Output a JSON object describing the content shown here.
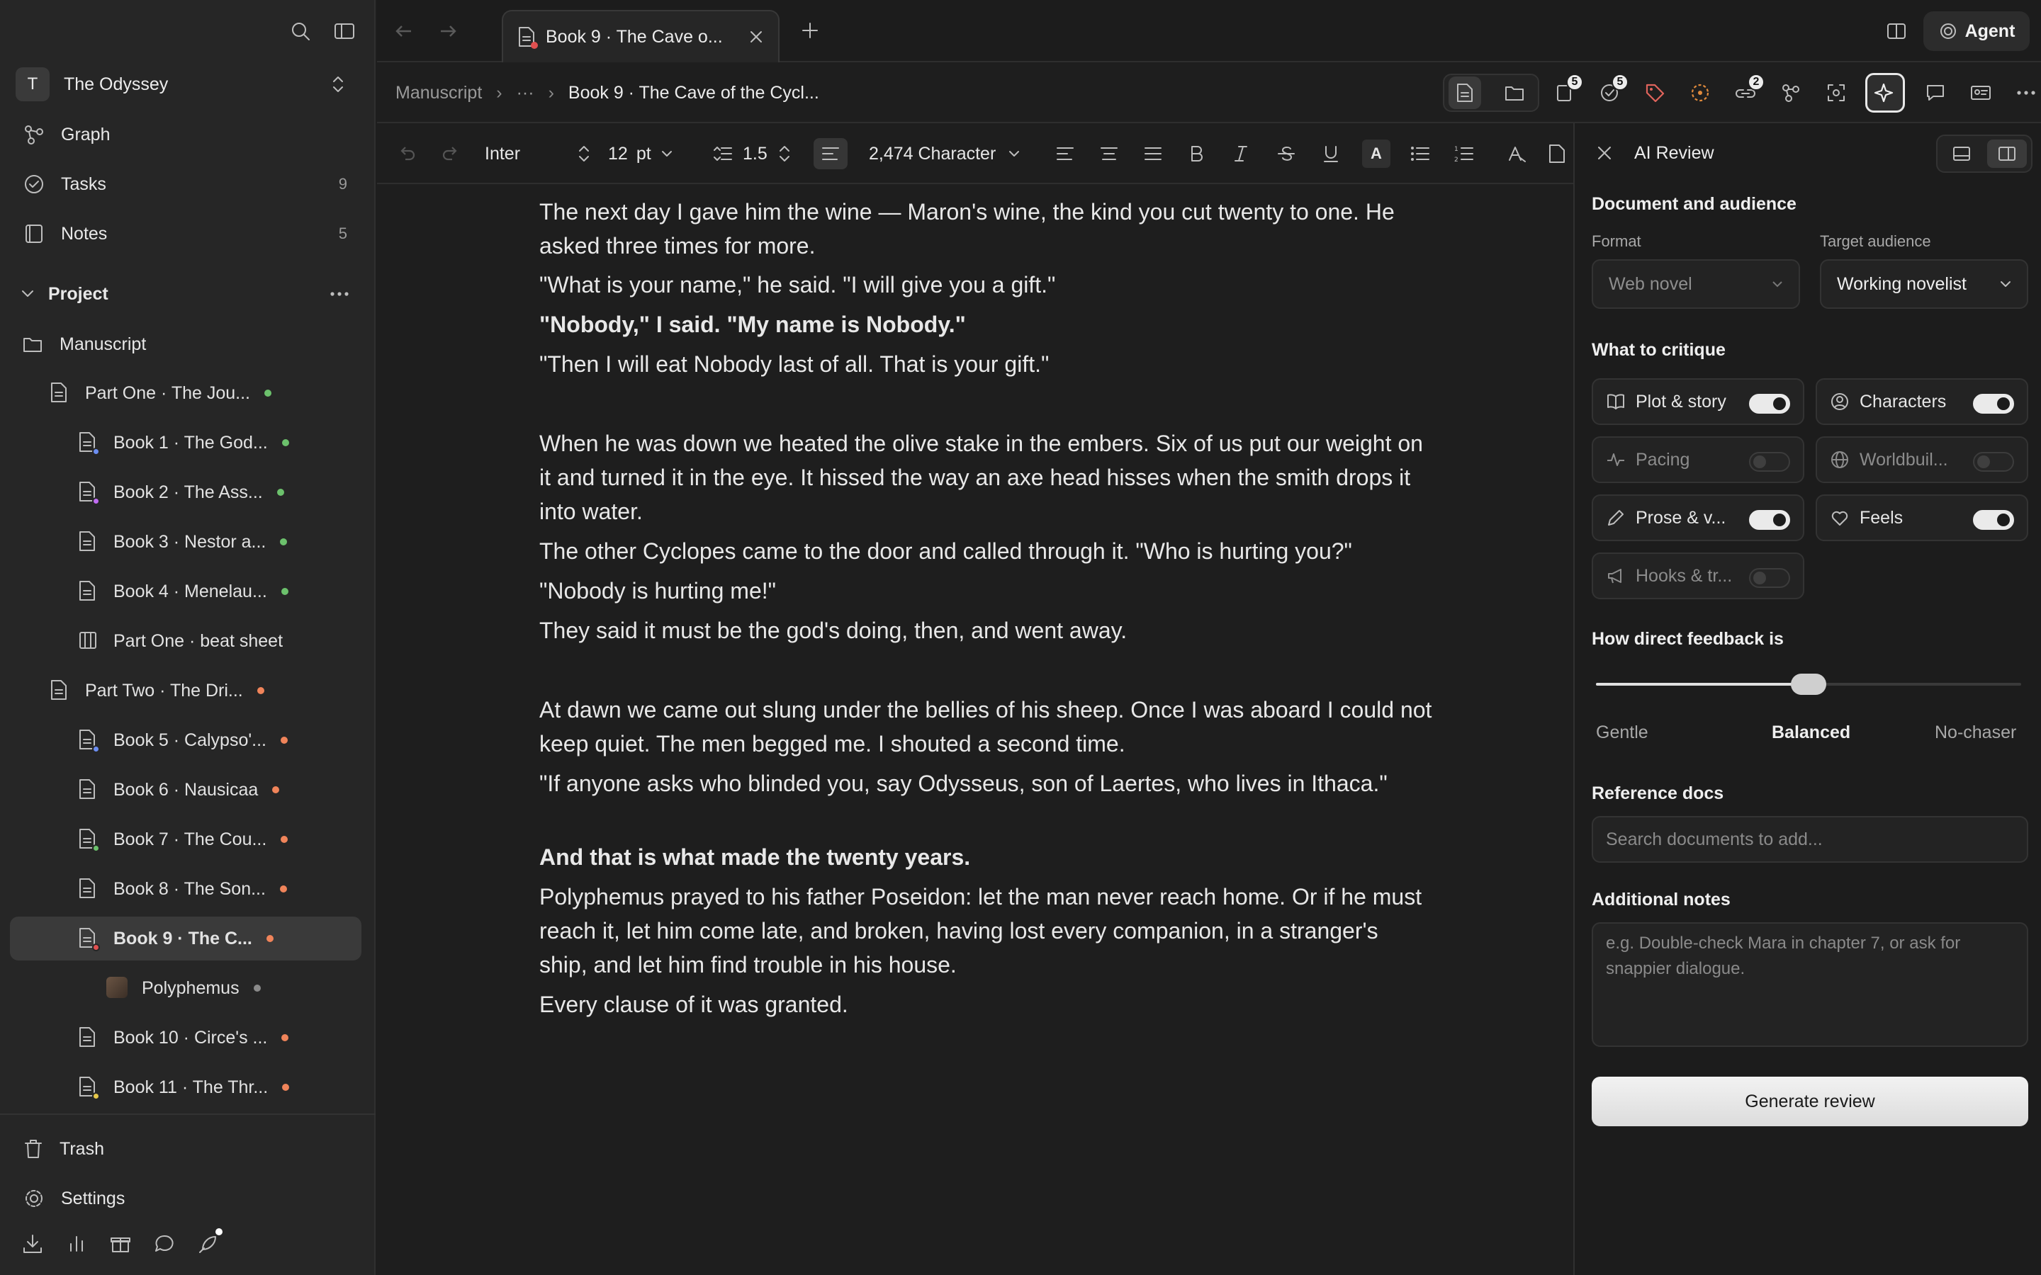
{
  "app": {
    "workspace_initial": "T",
    "workspace_name": "The Odyssey"
  },
  "sidebar": {
    "nav": [
      {
        "label": "Graph"
      },
      {
        "label": "Tasks",
        "count": "9"
      },
      {
        "label": "Notes",
        "count": "5"
      }
    ],
    "project_label": "Project",
    "manuscript_label": "Manuscript",
    "tree": [
      {
        "label": "Part One · The Jou...",
        "dot": "#6cc16c"
      },
      {
        "label": "Book 1 · The God...",
        "dot": "#6cc16c",
        "badge": "#6c8ef2"
      },
      {
        "label": "Book 2 · The Ass...",
        "dot": "#6cc16c",
        "badge": "#c06cf2"
      },
      {
        "label": "Book 3 · Nestor a...",
        "dot": "#6cc16c"
      },
      {
        "label": "Book 4 · Menelau...",
        "dot": "#6cc16c"
      },
      {
        "label": "Part One · beat sheet"
      },
      {
        "label": "Part Two · The Dri...",
        "dot": "#f0845a"
      },
      {
        "label": "Book 5 · Calypso'...",
        "dot": "#f0845a",
        "badge": "#6c8ef2"
      },
      {
        "label": "Book 6 · Nausicaa",
        "dot": "#f0845a"
      },
      {
        "label": "Book 7 · The Cou...",
        "dot": "#f0845a",
        "badge": "#6cc16c"
      },
      {
        "label": "Book 8 · The Son...",
        "dot": "#f0845a"
      },
      {
        "label": "Book 9 · The C...",
        "dot": "#f0845a",
        "badge": "#e05050"
      },
      {
        "label": "Polyphemus",
        "dot": "#8a8a8a"
      },
      {
        "label": "Book 10 · Circe's ...",
        "dot": "#f0845a"
      },
      {
        "label": "Book 11 · The Thr...",
        "dot": "#f0845a",
        "badge": "#e6c84a"
      }
    ],
    "trash_label": "Trash",
    "settings_label": "Settings"
  },
  "tab": {
    "title": "Book 9 · The Cave o..."
  },
  "agent_label": "Agent",
  "breadcrumb": {
    "root": "Manuscript",
    "ellipsis": "···",
    "current": "Book 9 · The Cave of the Cycl..."
  },
  "toolbar_badges": {
    "pages": "5",
    "tasks": "5",
    "links": "2"
  },
  "format": {
    "font": "Inter",
    "size": "12",
    "unit": "pt",
    "line_spacing": "1.5",
    "count": "2,474 Character"
  },
  "editor": {
    "paragraphs": [
      "The next day I gave him the wine — Maron's wine, the kind you cut twenty to one. He asked three times for more.",
      "\"What is your name,\" he said. \"I will give you a gift.\"",
      "\"Nobody,\" I said. \"My name is Nobody.\"",
      "\"Then I will eat Nobody last of all. That is your gift.\"",
      "When he was down we heated the olive stake in the embers. Six of us put our weight on it and turned it in the eye. It hissed the way an axe head hisses when the smith drops it into water.",
      "The other Cyclopes came to the door and called through it. \"Who is hurting you?\"",
      "\"Nobody is hurting me!\"",
      "They said it must be the god's doing, then, and went away.",
      "At dawn we came out slung under the bellies of his sheep. Once I was aboard I could not keep quiet. The men begged me. I shouted a second time.",
      "\"If anyone asks who blinded you, say Odysseus, son of Laertes, who lives in Ithaca.\"",
      "And that is what made the twenty years.",
      "Polyphemus prayed to his father Poseidon: let the man never reach home. Or if he must reach it, let him come late, and broken, having lost every companion, in a stranger's ship, and let him find trouble in his house.",
      "Every clause of it was granted."
    ]
  },
  "panel": {
    "title": "AI Review",
    "doc_heading": "Document and audience",
    "format_label": "Format",
    "format_value": "Web novel",
    "audience_label": "Target audience",
    "audience_value": "Working novelist",
    "critique_heading": "What to critique",
    "critiques": [
      {
        "label": "Plot & story",
        "on": true
      },
      {
        "label": "Characters",
        "on": true
      },
      {
        "label": "Pacing",
        "on": false
      },
      {
        "label": "Worldbuil...",
        "on": false
      },
      {
        "label": "Prose & v...",
        "on": true
      },
      {
        "label": "Feels",
        "on": true
      },
      {
        "label": "Hooks & tr...",
        "on": false
      }
    ],
    "direct_heading": "How direct feedback is",
    "direct_value": 0.5,
    "direct_labels": [
      "Gentle",
      "Balanced",
      "No-chaser"
    ],
    "refs_heading": "Reference docs",
    "refs_placeholder": "Search documents to add...",
    "notes_heading": "Additional notes",
    "notes_placeholder": "e.g. Double-check Mara in chapter 7, or ask for snappier dialogue.",
    "generate_label": "Generate review"
  }
}
